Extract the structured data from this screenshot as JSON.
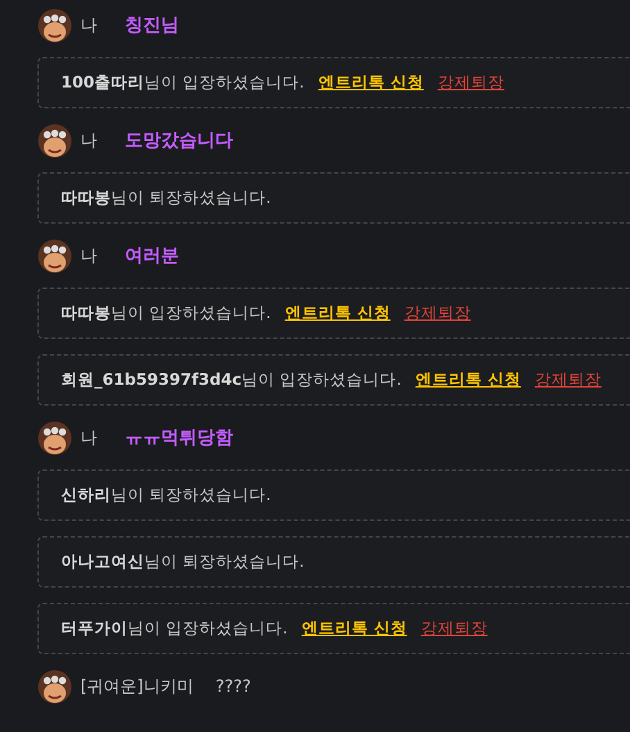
{
  "feed": [
    {
      "kind": "chat",
      "sender": "나",
      "text": "칭진님",
      "highlighted": true
    },
    {
      "kind": "notice",
      "user": "100출따리",
      "message": "님이 입장하셨습니다.",
      "actions": [
        {
          "kind": "entry",
          "label": "엔트리톡 신청"
        },
        {
          "kind": "kick",
          "label": "강제퇴장"
        }
      ]
    },
    {
      "kind": "chat",
      "sender": "나",
      "text": "도망갔습니다",
      "highlighted": true
    },
    {
      "kind": "notice",
      "user": "따따봉",
      "message": "님이 퇴장하셨습니다."
    },
    {
      "kind": "chat",
      "sender": "나",
      "text": "여러분",
      "highlighted": true
    },
    {
      "kind": "notice",
      "user": "따따봉",
      "message": "님이 입장하셨습니다.",
      "actions": [
        {
          "kind": "entry",
          "label": "엔트리톡 신청"
        },
        {
          "kind": "kick",
          "label": "강제퇴장"
        }
      ]
    },
    {
      "kind": "notice",
      "user": "회원_61b59397f3d4c",
      "message": "님이 입장하셨습니다.",
      "actions": [
        {
          "kind": "entry",
          "label": "엔트리톡 신청"
        },
        {
          "kind": "kick",
          "label": "강제퇴장"
        }
      ]
    },
    {
      "kind": "chat",
      "sender": "나",
      "text": "ㅠㅠ먹튀당함",
      "highlighted": true
    },
    {
      "kind": "notice",
      "user": "신하리",
      "message": "님이 퇴장하셨습니다."
    },
    {
      "kind": "notice",
      "user": "아나고여신",
      "message": "님이 퇴장하셨습니다."
    },
    {
      "kind": "notice",
      "user": "터푸가이",
      "message": "님이 입장하셨습니다.",
      "actions": [
        {
          "kind": "entry",
          "label": "엔트리톡 신청"
        },
        {
          "kind": "kick",
          "label": "강제퇴장"
        }
      ]
    },
    {
      "kind": "chat",
      "sender": "[귀여운]니키미",
      "text": "????",
      "highlighted": false
    }
  ]
}
